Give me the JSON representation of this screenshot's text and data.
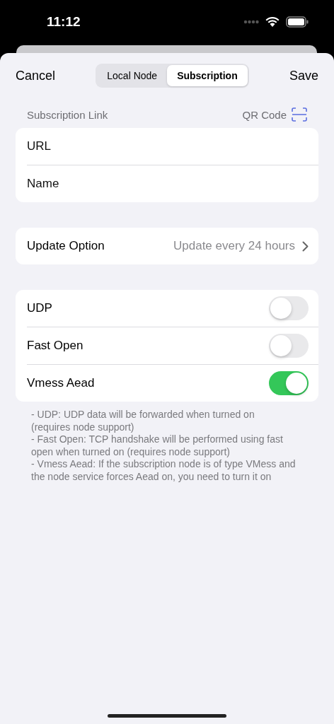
{
  "status_bar": {
    "time": "11:12"
  },
  "nav": {
    "cancel": "Cancel",
    "save": "Save",
    "segments": [
      {
        "label": "Local Node",
        "selected": false
      },
      {
        "label": "Subscription",
        "selected": true
      }
    ]
  },
  "subscription_link": {
    "header": "Subscription Link",
    "qr_label": "QR Code",
    "fields": [
      {
        "placeholder": "URL"
      },
      {
        "placeholder": "Name"
      }
    ]
  },
  "update_option": {
    "label": "Update Option",
    "value": "Update every 24 hours"
  },
  "toggles": [
    {
      "label": "UDP",
      "on": false
    },
    {
      "label": "Fast Open",
      "on": false
    },
    {
      "label": "Vmess Aead",
      "on": true
    }
  ],
  "notes": [
    "- UDP: UDP data will be forwarded when turned on (requires node support)",
    "- Fast Open: TCP handshake will be performed using fast open when turned on (requires node support)",
    "- Vmess Aead: If the subscription node is of type VMess and the node service forces Aead on, you need to turn it on"
  ]
}
